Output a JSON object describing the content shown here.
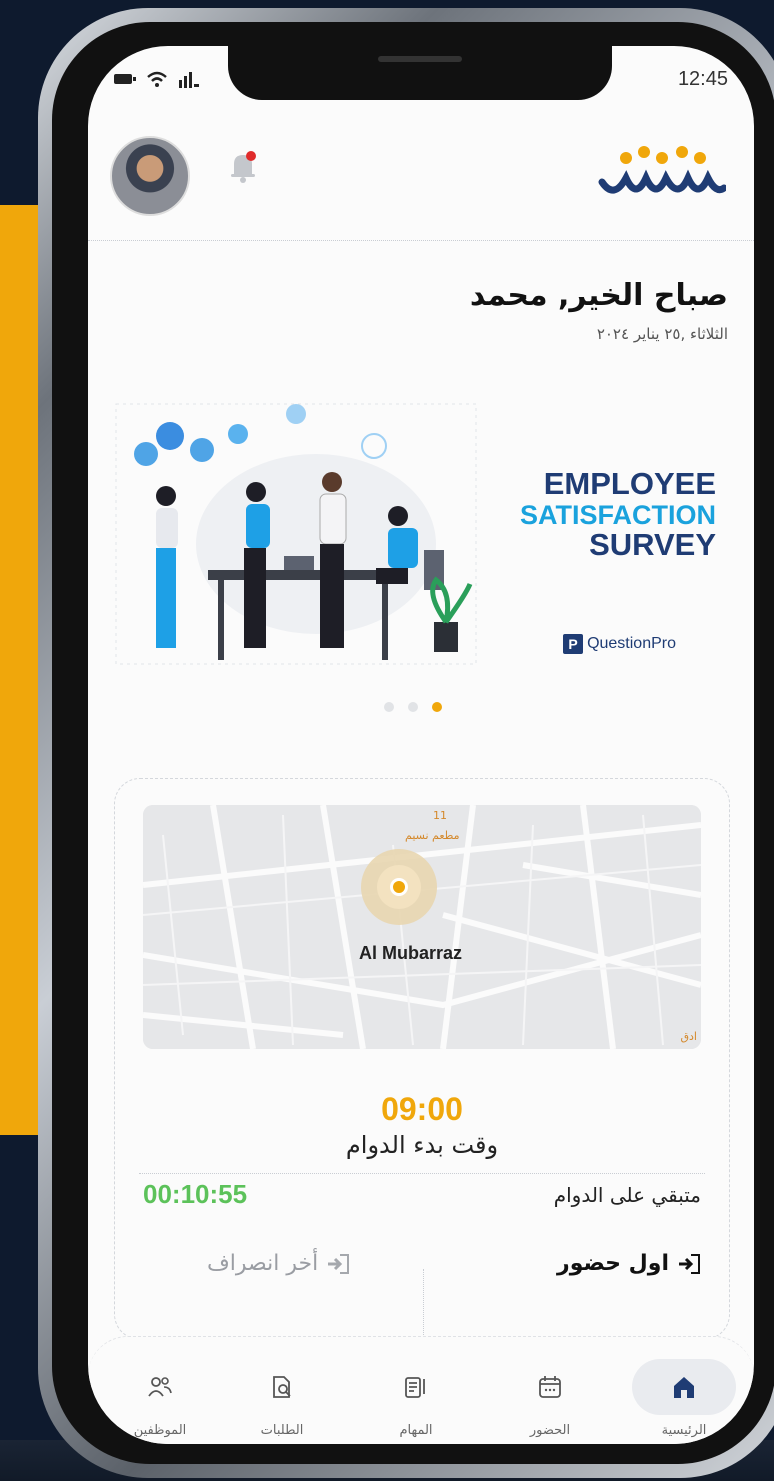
{
  "status": {
    "time": "12:45"
  },
  "greeting": {
    "title": "صباح الخير, محمد",
    "date": "الثلاثاء ,٢٥ يناير ٢٠٢٤"
  },
  "banner": {
    "line1": "EMPLOYEE",
    "line2": "SATISFACTION",
    "line3": "SURVEY",
    "brand_mark": "P",
    "brand_name": "QuestionPro"
  },
  "carousel": {
    "count": 3,
    "active_index": 2
  },
  "map": {
    "place": "Al Mubarraz",
    "poi_number": "11",
    "poi_name": "مطعم نسيم",
    "corner_label": "ادق"
  },
  "attendance": {
    "start_time": "09:00",
    "start_label": "وقت بدء الدوام",
    "remaining_time": "00:10:55",
    "remaining_label": "متبقي على الدوام",
    "first_in_label": "اول حضور",
    "last_out_label": "أخر انصراف"
  },
  "tabs": [
    {
      "icon": "home-icon",
      "label": "الرئيسية",
      "active": true
    },
    {
      "icon": "calendar-icon",
      "label": "الحضور",
      "active": false
    },
    {
      "icon": "tasks-icon",
      "label": "المهام",
      "active": false
    },
    {
      "icon": "requests-icon",
      "label": "الطلبات",
      "active": false
    },
    {
      "icon": "team-icon",
      "label": "الموظفين",
      "active": false
    }
  ],
  "colors": {
    "accent": "#f0a70b",
    "navy": "#1f3c74",
    "green": "#5cc25a"
  }
}
